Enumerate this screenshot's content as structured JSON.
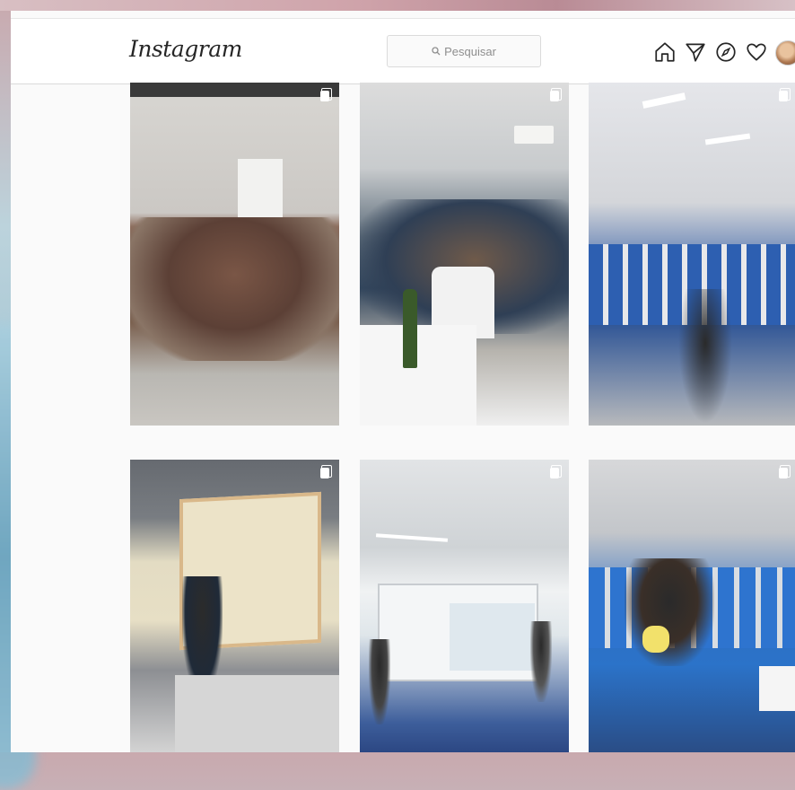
{
  "app": {
    "logo_text": "Instagram"
  },
  "search": {
    "placeholder": "Pesquisar"
  },
  "nav": {
    "icons": [
      "home-icon",
      "direct-message-icon",
      "explore-icon",
      "activity-heart-icon",
      "profile-avatar"
    ]
  },
  "posts": [
    {
      "id": 1,
      "multi": true
    },
    {
      "id": 2,
      "multi": true
    },
    {
      "id": 3,
      "multi": true
    },
    {
      "id": 4,
      "multi": true
    },
    {
      "id": 5,
      "multi": true
    },
    {
      "id": 6,
      "multi": true
    }
  ],
  "colors": {
    "text": "#262626",
    "muted": "#8e8e8e",
    "border": "#dbdbdb",
    "bg": "#fafafa"
  }
}
